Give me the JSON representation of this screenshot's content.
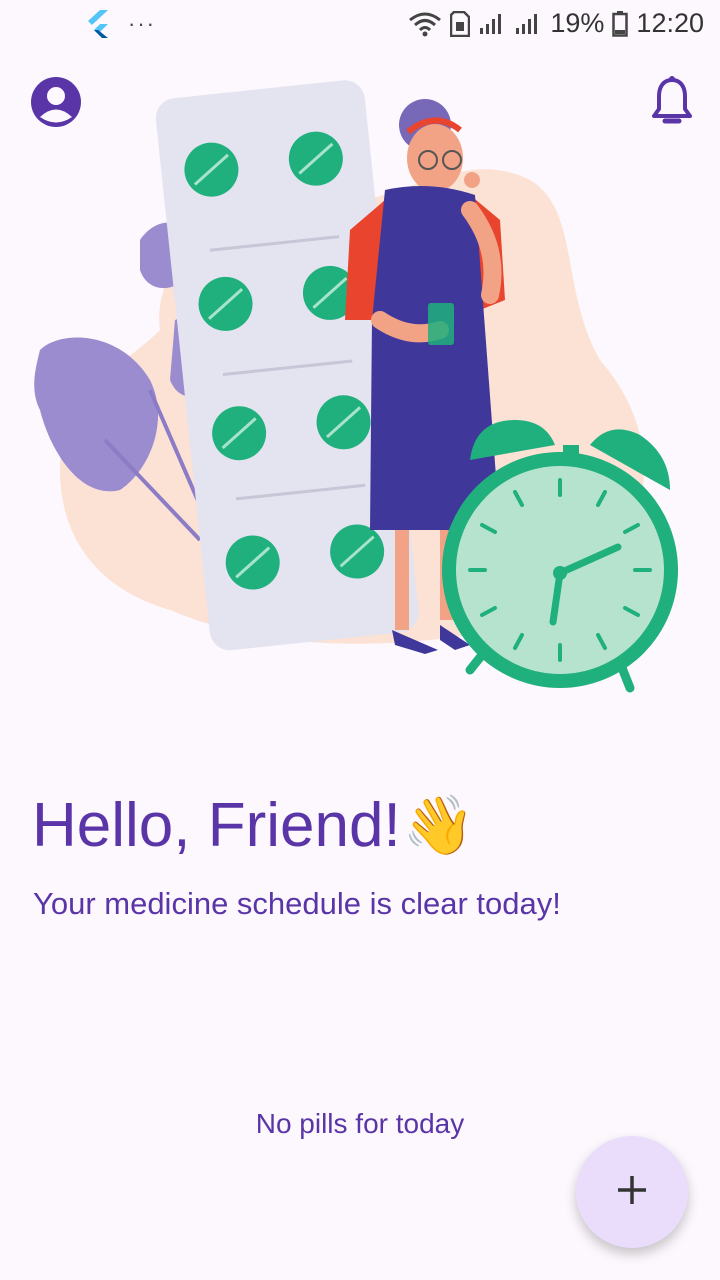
{
  "status_bar": {
    "battery": "19%",
    "time": "12:20",
    "icons": [
      "flutter-icon",
      "more-dots-icon",
      "wifi-icon",
      "sim-icon",
      "signal-icon",
      "signal-icon",
      "battery-icon"
    ]
  },
  "header": {
    "profile_icon": "account-circle-icon",
    "notifications_icon": "bell-icon"
  },
  "greeting": {
    "title": "Hello, Friend!",
    "emoji": "👋",
    "subtitle": "Your medicine schedule is clear today!"
  },
  "empty_state": {
    "message": "No pills for today"
  },
  "fab": {
    "icon": "plus-icon"
  },
  "colors": {
    "primary": "#5a35a8",
    "background": "#fdf8fd",
    "fab_bg": "#e9ddfb",
    "pill_green": "#1fb07d"
  }
}
